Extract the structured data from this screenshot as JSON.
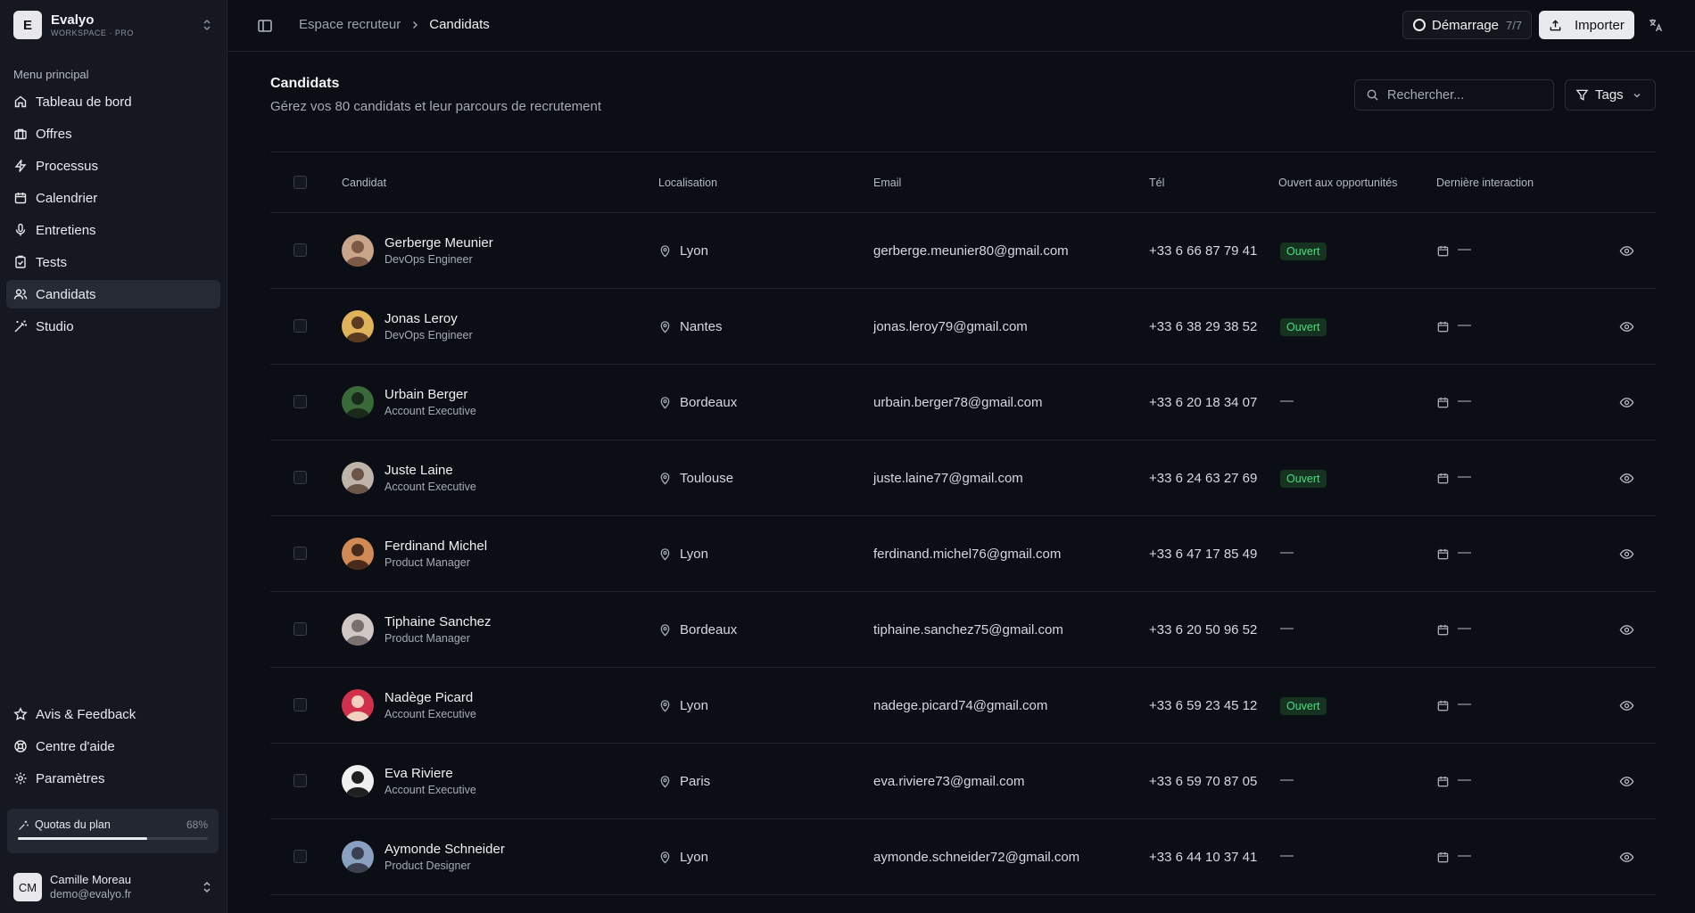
{
  "workspace": {
    "logo_letter": "E",
    "name": "Evalyo",
    "plan": "WORKSPACE · PRO"
  },
  "sidebar": {
    "section_label": "Menu principal",
    "items": [
      {
        "label": "Tableau de bord",
        "icon": "home-icon"
      },
      {
        "label": "Offres",
        "icon": "briefcase-icon"
      },
      {
        "label": "Processus",
        "icon": "bolt-icon"
      },
      {
        "label": "Calendrier",
        "icon": "calendar-icon"
      },
      {
        "label": "Entretiens",
        "icon": "microphone-icon"
      },
      {
        "label": "Tests",
        "icon": "clipboard-check-icon"
      },
      {
        "label": "Candidats",
        "icon": "users-icon",
        "active": true
      },
      {
        "label": "Studio",
        "icon": "magic-wand-icon"
      }
    ],
    "bottom_items": [
      {
        "label": "Avis & Feedback",
        "icon": "star-icon"
      },
      {
        "label": "Centre d'aide",
        "icon": "lifebuoy-icon"
      },
      {
        "label": "Paramètres",
        "icon": "gear-icon"
      }
    ],
    "quota": {
      "label": "Quotas du plan",
      "percent_text": "68%",
      "percent": 68
    },
    "user": {
      "initials": "CM",
      "name": "Camille Moreau",
      "email": "demo@evalyo.fr"
    }
  },
  "topbar": {
    "breadcrumb": [
      "Espace recruteur",
      "Candidats"
    ],
    "start_label": "Démarrage",
    "start_count": "7/7",
    "import_label": "Importer"
  },
  "main": {
    "title": "Candidats",
    "subtitle": "Gérez vos 80 candidats et leur parcours de recrutement",
    "search_placeholder": "Rechercher...",
    "tags_label": "Tags",
    "columns": [
      "Candidat",
      "Localisation",
      "Email",
      "Tél",
      "Ouvert aux opportunités",
      "Dernière interaction"
    ],
    "rows": [
      {
        "name": "Gerberge Meunier",
        "role": "DevOps Engineer",
        "location": "Lyon",
        "email": "gerberge.meunier80@gmail.com",
        "phone": "+33 6 66 87 79 41",
        "open": "Ouvert",
        "last": "—"
      },
      {
        "name": "Jonas Leroy",
        "role": "DevOps Engineer",
        "location": "Nantes",
        "email": "jonas.leroy79@gmail.com",
        "phone": "+33 6 38 29 38 52",
        "open": "Ouvert",
        "last": "—"
      },
      {
        "name": "Urbain Berger",
        "role": "Account Executive",
        "location": "Bordeaux",
        "email": "urbain.berger78@gmail.com",
        "phone": "+33 6 20 18 34 07",
        "open": "—",
        "last": "—"
      },
      {
        "name": "Juste Laine",
        "role": "Account Executive",
        "location": "Toulouse",
        "email": "juste.laine77@gmail.com",
        "phone": "+33 6 24 63 27 69",
        "open": "Ouvert",
        "last": "—"
      },
      {
        "name": "Ferdinand Michel",
        "role": "Product Manager",
        "location": "Lyon",
        "email": "ferdinand.michel76@gmail.com",
        "phone": "+33 6 47 17 85 49",
        "open": "—",
        "last": "—"
      },
      {
        "name": "Tiphaine Sanchez",
        "role": "Product Manager",
        "location": "Bordeaux",
        "email": "tiphaine.sanchez75@gmail.com",
        "phone": "+33 6 20 50 96 52",
        "open": "—",
        "last": "—"
      },
      {
        "name": "Nadège Picard",
        "role": "Account Executive",
        "location": "Lyon",
        "email": "nadege.picard74@gmail.com",
        "phone": "+33 6 59 23 45 12",
        "open": "Ouvert",
        "last": "—"
      },
      {
        "name": "Eva Riviere",
        "role": "Account Executive",
        "location": "Paris",
        "email": "eva.riviere73@gmail.com",
        "phone": "+33 6 59 70 87 05",
        "open": "—",
        "last": "—"
      },
      {
        "name": "Aymonde Schneider",
        "role": "Product Designer",
        "location": "Lyon",
        "email": "aymonde.schneider72@gmail.com",
        "phone": "+33 6 44 10 37 41",
        "open": "—",
        "last": "—"
      }
    ]
  },
  "colors": {
    "accent_green": "#4ade80",
    "badge_bg": "#163322",
    "background": "#0b0e15",
    "sidebar": "#151820"
  }
}
